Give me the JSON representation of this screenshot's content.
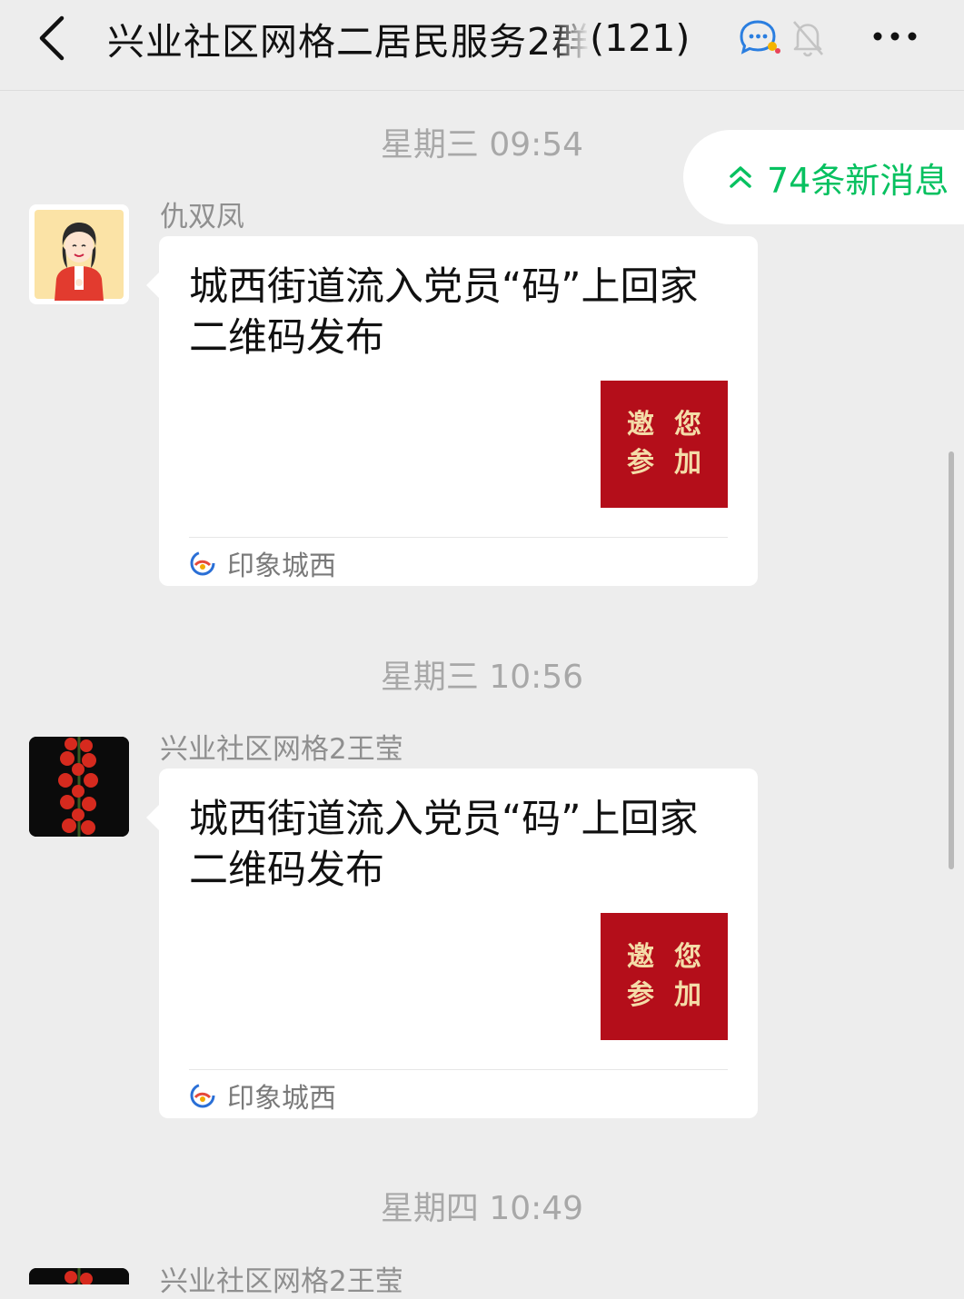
{
  "header": {
    "title": "兴业社区网格二居民服务2群",
    "member_count": "(121)"
  },
  "new_messages": {
    "label": "74条新消息"
  },
  "messages": [
    {
      "timestamp": "星期三 09:54",
      "sender": "仇双凤",
      "card": {
        "title": "城西街道流入党员“码”上回家二维码发布",
        "thumb_text": [
          "邀",
          "您",
          "参",
          "加"
        ],
        "source": "印象城西"
      }
    },
    {
      "timestamp": "星期三 10:56",
      "sender": "兴业社区网格2王莹",
      "card": {
        "title": "城西街道流入党员“码”上回家二维码发布",
        "thumb_text": [
          "邀",
          "您",
          "参",
          "加"
        ],
        "source": "印象城西"
      }
    },
    {
      "timestamp": "星期四 10:49",
      "sender": "兴业社区网格2王莹"
    }
  ],
  "colors": {
    "accent": "#07c160",
    "background": "#ededed",
    "thumb_red": "#b40e1a"
  },
  "icons": [
    "back-arrow-icon",
    "chat-bubble-icon",
    "mute-bell-icon",
    "more-icon",
    "double-chevron-up-icon",
    "source-logo-icon"
  ]
}
